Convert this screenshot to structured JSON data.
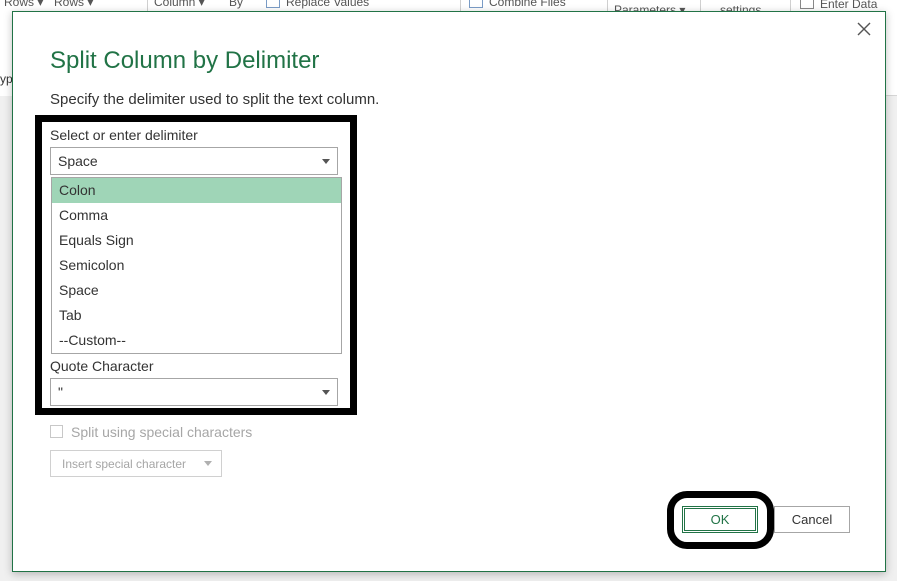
{
  "ribbon": {
    "items": [
      "Rows ▾",
      "Rows ▾",
      "Column ▾",
      "By",
      "Replace Values",
      "Combine Files",
      "Parameters ▾",
      "settings",
      "Enter Data"
    ],
    "left_fragment": "yp"
  },
  "dialog": {
    "title": "Split Column by Delimiter",
    "subtitle": "Specify the delimiter used to split the text column.",
    "delimiter": {
      "label": "Select or enter delimiter",
      "value": "Space",
      "options": [
        "Colon",
        "Comma",
        "Equals Sign",
        "Semicolon",
        "Space",
        "Tab",
        "--Custom--"
      ],
      "highlighted": "Colon"
    },
    "quote": {
      "label": "Quote Character",
      "value": "\""
    },
    "special_chars_checkbox": {
      "label": "Split using special characters",
      "checked": false,
      "enabled": false
    },
    "insert_special_label": "Insert special character",
    "ok_label": "OK",
    "cancel_label": "Cancel"
  },
  "colors": {
    "accent": "#217346",
    "selection": "#9fd5b7",
    "highlight_annotation": "#000000"
  }
}
